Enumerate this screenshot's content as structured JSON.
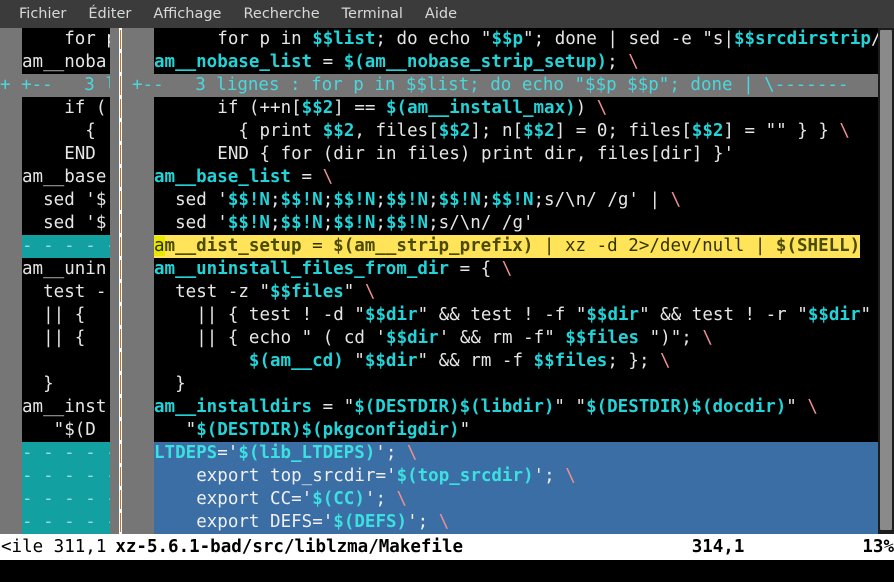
{
  "menu": {
    "items": [
      {
        "label": "Fichier",
        "name": "menu-fichier"
      },
      {
        "label": "Éditer",
        "name": "menu-editer"
      },
      {
        "label": "Affichage",
        "name": "menu-affichage"
      },
      {
        "label": "Recherche",
        "name": "menu-recherche"
      },
      {
        "label": "Terminal",
        "name": "menu-terminal"
      },
      {
        "label": "Aide",
        "name": "menu-aide"
      }
    ]
  },
  "editor": {
    "left_pane": {
      "lines": [
        "    for p ",
        "am__noba",
        "+--   3 l",
        "    if (",
        "      {",
        "    END",
        "am__base",
        "  sed '$",
        "  sed '$",
        "--------",
        "am__unin",
        "  test -",
        "  || {",
        "  || {",
        "",
        "  }",
        "am__inst",
        "   \"$(D",
        "--------",
        "--------",
        "--------",
        "--------"
      ]
    },
    "right_pane": {
      "lines": [
        "      for p in $$list; do echo \"$$p\"; done | sed -e \"s|$$srcdirstrip/||",
        "am__nobase_list = $(am__nobase_strip_setup); \\",
        "+--   3 lignes : for p in $$list; do echo \"$$p $$p\"; done | \\-------",
        "      if (++n[$$2] == $(am__install_max)) \\",
        "        { print $$2, files[$$2]; n[$$2] = 0; files[$$2] = \"\" } } \\",
        "      END { for (dir in files) print dir, files[dir] }'",
        "am__base_list = \\",
        "  sed '$$!N;$$!N;$$!N;$$!N;$$!N;$$!N;s/\\n/ /g' | \\",
        "  sed '$$!N;$$!N;$$!N;$$!N;s/\\n/ /g'",
        "am__dist_setup = $(am__strip_prefix) | xz -d 2>/dev/null | $(SHELL)",
        "am__uninstall_files_from_dir = { \\",
        "  test -z \"$$files\" \\",
        "    || { test ! -d \"$$dir\" && test ! -f \"$$dir\" && test ! -r \"$$dir\"",
        "    || { echo \" ( cd '$$dir' && rm -f\" $$files \")\"; \\",
        "         $(am__cd) \"$$dir\" && rm -f $$files; }; \\",
        "  }",
        "am__installdirs = \"$(DESTDIR)$(libdir)\" \"$(DESTDIR)$(docdir)\" \\",
        "   \"$(DESTDIR)$(pkgconfigdir)\"",
        "LTDEPS='$(lib_LTDEPS)'; \\",
        "    export top_srcdir='$(top_srcdir)'; \\",
        "    export CC='$(CC)'; \\",
        "    export DEFS='$(DEFS)'; \\"
      ]
    },
    "cursor_line_text": "am__dist_setup = $(am__strip_prefix) | xz -d 2>/dev/null | $(SHELL)",
    "fold_text": "3 lignes"
  },
  "status": {
    "left_file": "<ile 311,1",
    "filename": "xz-5.6.1-bad/src/liblzma/Makefile",
    "position": "314,1",
    "percent": "13%"
  },
  "colors": {
    "menubar_bg": "#3b3b3b",
    "terminal_bg": "#000000",
    "identifier": "#22d3d8",
    "cursor_line_bg": "#ffe358",
    "diff_add_bg": "#3a6ea5",
    "diff_fill_bg": "#13a0a0",
    "fold_bg": "#767676",
    "status_bg": "#ffffff"
  }
}
